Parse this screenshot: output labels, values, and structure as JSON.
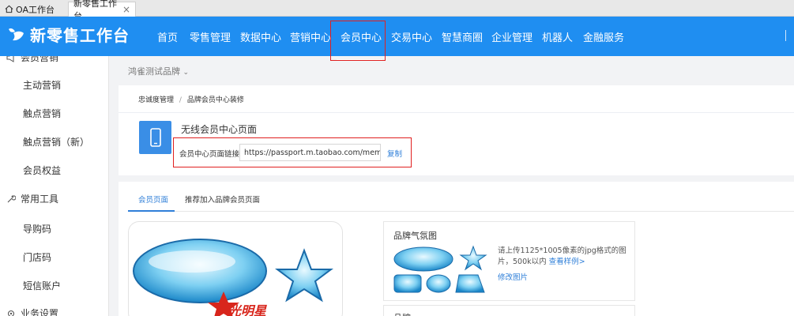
{
  "tabs": [
    {
      "label": "OA工作台",
      "icon": "home-icon"
    },
    {
      "label": "新零售工作台",
      "close": "×"
    }
  ],
  "header": {
    "brand": "新零售工作台",
    "nav": [
      "首页",
      "零售管理",
      "数据中心",
      "营销中心",
      "会员中心",
      "交易中心",
      "智慧商圈",
      "企业管理",
      "机器人",
      "金融服务"
    ],
    "active_nav": "会员中心",
    "bg": "#1f8ef1"
  },
  "sidebar": {
    "cut_item": "会员营销",
    "items1": [
      "主动营销",
      "触点营销",
      "触点营销（新）",
      "会员权益"
    ],
    "group_tools": "常用工具",
    "items2": [
      "导购码",
      "门店码",
      "短信账户"
    ],
    "group_settings": "业务设置"
  },
  "main": {
    "brand_select": "鸿雀测试品牌",
    "breadcrumb": {
      "parent": "忠诚度管理",
      "sep": "/",
      "current": "品牌会员中心装修"
    },
    "page_title": "无线会员中心页面",
    "link_label": "会员中心页面链接",
    "link_value": "https://passport.m.taobao.com/member/de",
    "copy_label": "复制",
    "subtabs": [
      "会员页面",
      "推荐加入品牌会员页面"
    ],
    "preview_logo_text": "光明星",
    "atmosphere": {
      "title": "品牌气氛图",
      "desc": "请上传1125*1005像素的jpg格式的图片，500k以内",
      "sample_link": "查看样例>",
      "edit_link": "修改图片"
    },
    "card2_title": "品牌"
  },
  "colors": {
    "accent": "#2f7fd8",
    "highlight": "#e02020"
  }
}
